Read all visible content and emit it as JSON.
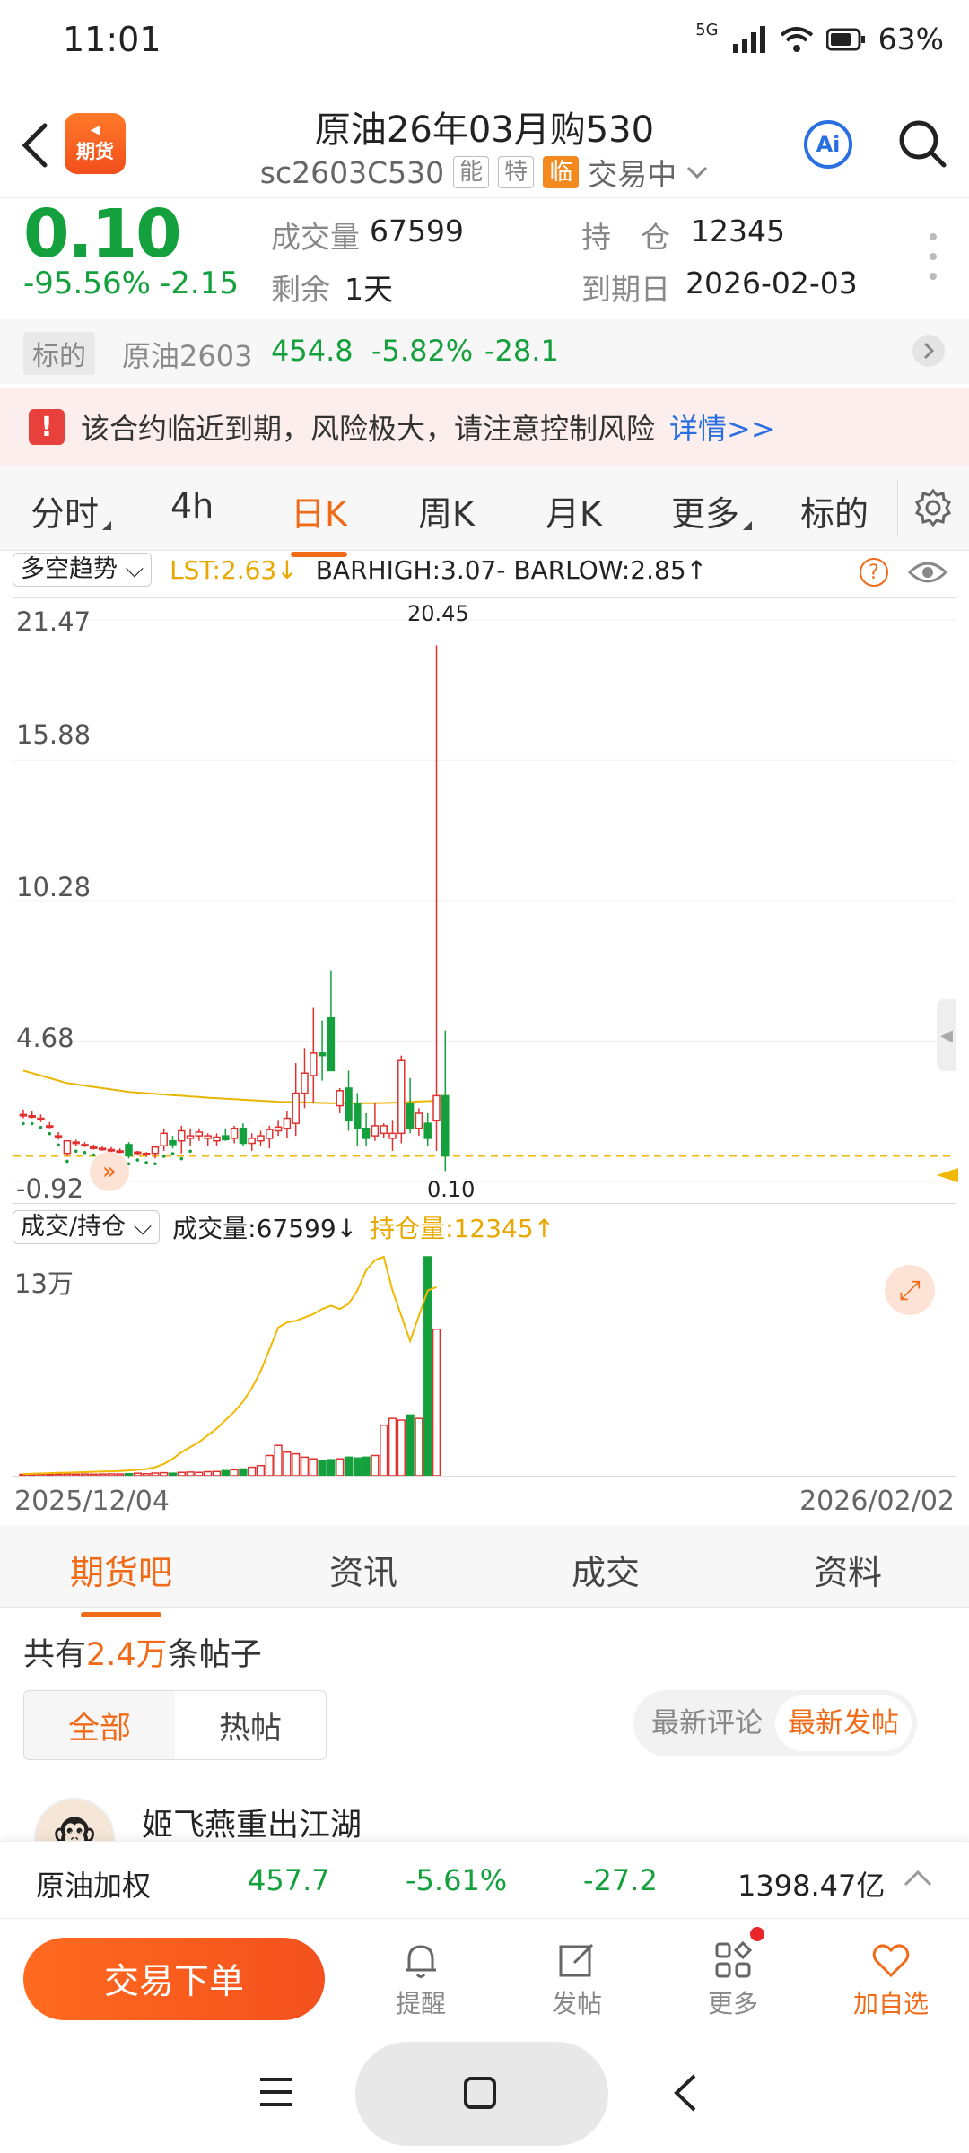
{
  "status_bar": {
    "time": "11:01",
    "network": "5G",
    "battery": "63%"
  },
  "header": {
    "logo_text": "期货",
    "title": "原油26年03月购530",
    "code": "sc2603C530",
    "tags": [
      "能",
      "特",
      "临"
    ],
    "status": "交易中"
  },
  "quote": {
    "price": "0.10",
    "change_pct": "-95.56%",
    "change": "-2.15",
    "volume_label": "成交量",
    "volume": "67599",
    "position_label": "持　仓",
    "position": "12345",
    "remaining_label": "剩余",
    "remaining": "1天",
    "expiry_label": "到期日",
    "expiry": "2026-02-03"
  },
  "underlying": {
    "label": "标的",
    "name": "原油2603",
    "price": "454.8",
    "change_pct": "-5.82%",
    "change": "-28.1"
  },
  "warning": {
    "text": "该合约临近到期，风险极大，请注意控制风险",
    "link": "详情>>"
  },
  "period_tabs": [
    {
      "label": "分时",
      "active": false
    },
    {
      "label": "4h",
      "active": false
    },
    {
      "label": "日K",
      "active": true
    },
    {
      "label": "周K",
      "active": false
    },
    {
      "label": "月K",
      "active": false
    },
    {
      "label": "更多",
      "active": false
    },
    {
      "label": "标的",
      "active": false
    }
  ],
  "indicator": {
    "name": "多空趋势",
    "lst": "LST:2.63↓",
    "bar": "BARHIGH:3.07- BARLOW:2.85↑"
  },
  "price_axis": {
    "labels": [
      "21.47",
      "15.88",
      "10.28",
      "4.68",
      "-0.92"
    ]
  },
  "chart_annotations": {
    "high": "20.45",
    "last": "0.10"
  },
  "volume_panel": {
    "selector": "成交/持仓",
    "volume_text": "成交量:67599↓",
    "position_text": "持仓量:12345↑",
    "y_label": "13万"
  },
  "date_range": {
    "start": "2025/12/04",
    "end": "2026/02/02"
  },
  "colors": {
    "up": "#e0312f",
    "down": "#14a03c",
    "accent": "#f06a17",
    "position_line": "#f0b800"
  },
  "chart_data": {
    "type": "candlestick",
    "ylim": [
      -0.92,
      21.47
    ],
    "candles": [
      {
        "o": 1.75,
        "h": 1.95,
        "l": 1.6,
        "c": 1.75
      },
      {
        "o": 1.7,
        "h": 1.9,
        "l": 1.6,
        "c": 1.7
      },
      {
        "o": 1.6,
        "h": 1.75,
        "l": 1.45,
        "c": 1.6
      },
      {
        "o": 1.3,
        "h": 1.45,
        "l": 1.2,
        "c": 1.3
      },
      {
        "o": 0.9,
        "h": 1.05,
        "l": 0.75,
        "c": 0.9
      },
      {
        "o": 0.2,
        "h": 0.7,
        "l": 0.1,
        "c": 0.7
      },
      {
        "o": 0.65,
        "h": 0.75,
        "l": 0.5,
        "c": 0.65
      },
      {
        "o": 0.55,
        "h": 0.65,
        "l": 0.45,
        "c": 0.55
      },
      {
        "o": 0.45,
        "h": 0.55,
        "l": 0.35,
        "c": 0.45
      },
      {
        "o": 0.4,
        "h": 0.5,
        "l": 0.3,
        "c": 0.4
      },
      {
        "o": 0.35,
        "h": 0.45,
        "l": 0.25,
        "c": 0.35
      },
      {
        "o": 0.3,
        "h": 0.4,
        "l": 0.2,
        "c": 0.3
      },
      {
        "o": 0.55,
        "h": 0.65,
        "l": 0.0,
        "c": 0.1
      },
      {
        "o": 0.25,
        "h": 0.3,
        "l": 0.15,
        "c": 0.25
      },
      {
        "o": 0.2,
        "h": 0.25,
        "l": 0.05,
        "c": 0.2
      },
      {
        "o": 0.2,
        "h": 0.5,
        "l": 0.0,
        "c": 0.45
      },
      {
        "o": 0.5,
        "h": 1.2,
        "l": 0.3,
        "c": 1.0
      },
      {
        "o": 0.7,
        "h": 0.9,
        "l": 0.4,
        "c": 0.55
      },
      {
        "o": 0.7,
        "h": 1.3,
        "l": 0.2,
        "c": 1.1
      },
      {
        "o": 0.8,
        "h": 1.2,
        "l": 0.5,
        "c": 0.9
      },
      {
        "o": 0.9,
        "h": 1.2,
        "l": 0.7,
        "c": 1.05
      },
      {
        "o": 0.8,
        "h": 1.0,
        "l": 0.5,
        "c": 0.9
      },
      {
        "o": 0.7,
        "h": 1.0,
        "l": 0.5,
        "c": 0.85
      },
      {
        "o": 0.9,
        "h": 1.2,
        "l": 0.7,
        "c": 0.75
      },
      {
        "o": 0.8,
        "h": 1.3,
        "l": 0.6,
        "c": 1.2
      },
      {
        "o": 1.2,
        "h": 1.4,
        "l": 0.5,
        "c": 0.6
      },
      {
        "o": 0.6,
        "h": 1.0,
        "l": 0.3,
        "c": 0.8
      },
      {
        "o": 0.7,
        "h": 1.1,
        "l": 0.5,
        "c": 0.9
      },
      {
        "o": 0.8,
        "h": 1.3,
        "l": 0.4,
        "c": 1.15
      },
      {
        "o": 1.1,
        "h": 1.5,
        "l": 0.9,
        "c": 1.25
      },
      {
        "o": 1.2,
        "h": 1.9,
        "l": 0.8,
        "c": 1.6
      },
      {
        "o": 1.4,
        "h": 3.8,
        "l": 0.9,
        "c": 2.6
      },
      {
        "o": 2.6,
        "h": 4.4,
        "l": 2.0,
        "c": 3.4
      },
      {
        "o": 3.3,
        "h": 6.0,
        "l": 2.2,
        "c": 4.2
      },
      {
        "o": 4.2,
        "h": 5.5,
        "l": 3.1,
        "c": 4.1
      },
      {
        "o": 5.6,
        "h": 7.5,
        "l": 4.0,
        "c": 3.5
      },
      {
        "o": 2.1,
        "h": 2.8,
        "l": 1.8,
        "c": 2.7
      },
      {
        "o": 2.8,
        "h": 3.5,
        "l": 1.1,
        "c": 1.5
      },
      {
        "o": 2.2,
        "h": 2.6,
        "l": 0.5,
        "c": 1.2
      },
      {
        "o": 1.2,
        "h": 1.8,
        "l": 0.5,
        "c": 0.8
      },
      {
        "o": 0.9,
        "h": 2.2,
        "l": 0.7,
        "c": 1.3
      },
      {
        "o": 1.0,
        "h": 1.4,
        "l": 0.8,
        "c": 1.3
      },
      {
        "o": 0.8,
        "h": 1.5,
        "l": 0.3,
        "c": 1.0
      },
      {
        "o": 1.0,
        "h": 4.1,
        "l": 0.6,
        "c": 3.9
      },
      {
        "o": 2.2,
        "h": 3.2,
        "l": 1.0,
        "c": 1.2
      },
      {
        "o": 1.2,
        "h": 2.0,
        "l": 0.9,
        "c": 1.8
      },
      {
        "o": 1.4,
        "h": 1.8,
        "l": 0.5,
        "c": 0.8
      },
      {
        "o": 1.5,
        "h": 20.45,
        "l": 0.3,
        "c": 2.5
      },
      {
        "o": 2.5,
        "h": 5.1,
        "l": -0.5,
        "c": 0.1
      }
    ],
    "ma": [
      3.5,
      3.4,
      3.3,
      3.2,
      3.1,
      3.0,
      2.95,
      2.9,
      2.85,
      2.8,
      2.75,
      2.7,
      2.65,
      2.62,
      2.6,
      2.57,
      2.55,
      2.52,
      2.5,
      2.47,
      2.45,
      2.42,
      2.4,
      2.38,
      2.36,
      2.34,
      2.32,
      2.3,
      2.28,
      2.26,
      2.25,
      2.24,
      2.23,
      2.22,
      2.21,
      2.2,
      2.2,
      2.2,
      2.2,
      2.2,
      2.2,
      2.21,
      2.22,
      2.23,
      2.25,
      2.27,
      2.28,
      2.3,
      2.32
    ],
    "volumes": [
      800,
      700,
      900,
      800,
      900,
      1000,
      900,
      1000,
      900,
      1000,
      1100,
      1000,
      1200,
      1500,
      1200,
      1600,
      1800,
      1500,
      2000,
      2200,
      2000,
      2400,
      2500,
      3000,
      3500,
      4000,
      5000,
      6000,
      12000,
      18000,
      14000,
      13000,
      11000,
      10000,
      9000,
      9500,
      10000,
      11000,
      10500,
      11000,
      12000,
      30000,
      34000,
      33000,
      36000,
      34000,
      130000,
      87000
    ],
    "open_interest": [
      1000,
      1200,
      1300,
      1500,
      1700,
      1800,
      2000,
      2100,
      2300,
      2500,
      2600,
      2800,
      3100,
      3500,
      4000,
      5000,
      7000,
      10000,
      14000,
      17000,
      20000,
      24000,
      28000,
      33000,
      38000,
      44000,
      52000,
      62000,
      75000,
      88000,
      91000,
      92000,
      94000,
      96000,
      99000,
      101000,
      99000,
      102000,
      110000,
      122000,
      128000,
      130000,
      110000,
      95000,
      80000,
      95000,
      110000,
      112000
    ]
  },
  "bottom_tabs": [
    {
      "label": "期货吧",
      "active": true
    },
    {
      "label": "资讯",
      "active": false
    },
    {
      "label": "成交",
      "active": false
    },
    {
      "label": "资料",
      "active": false
    }
  ],
  "posts": {
    "prefix": "共有",
    "count": "2.4万",
    "suffix": "条帖子",
    "filter_all": "全部",
    "filter_hot": "热帖",
    "sort_comment": "最新评论",
    "sort_post": "最新发帖",
    "first_author": "姬飞燕重出江湖"
  },
  "ticker": {
    "name": "原油加权",
    "price": "457.7",
    "change_pct": "-5.61%",
    "change": "-27.2",
    "amount": "1398.47亿"
  },
  "actions": {
    "trade": "交易下单",
    "items": [
      {
        "icon": "bell-icon",
        "label": "提醒"
      },
      {
        "icon": "edit-icon",
        "label": "发帖"
      },
      {
        "icon": "grid-icon",
        "label": "更多"
      },
      {
        "icon": "heart-icon",
        "label": "加自选"
      }
    ]
  }
}
